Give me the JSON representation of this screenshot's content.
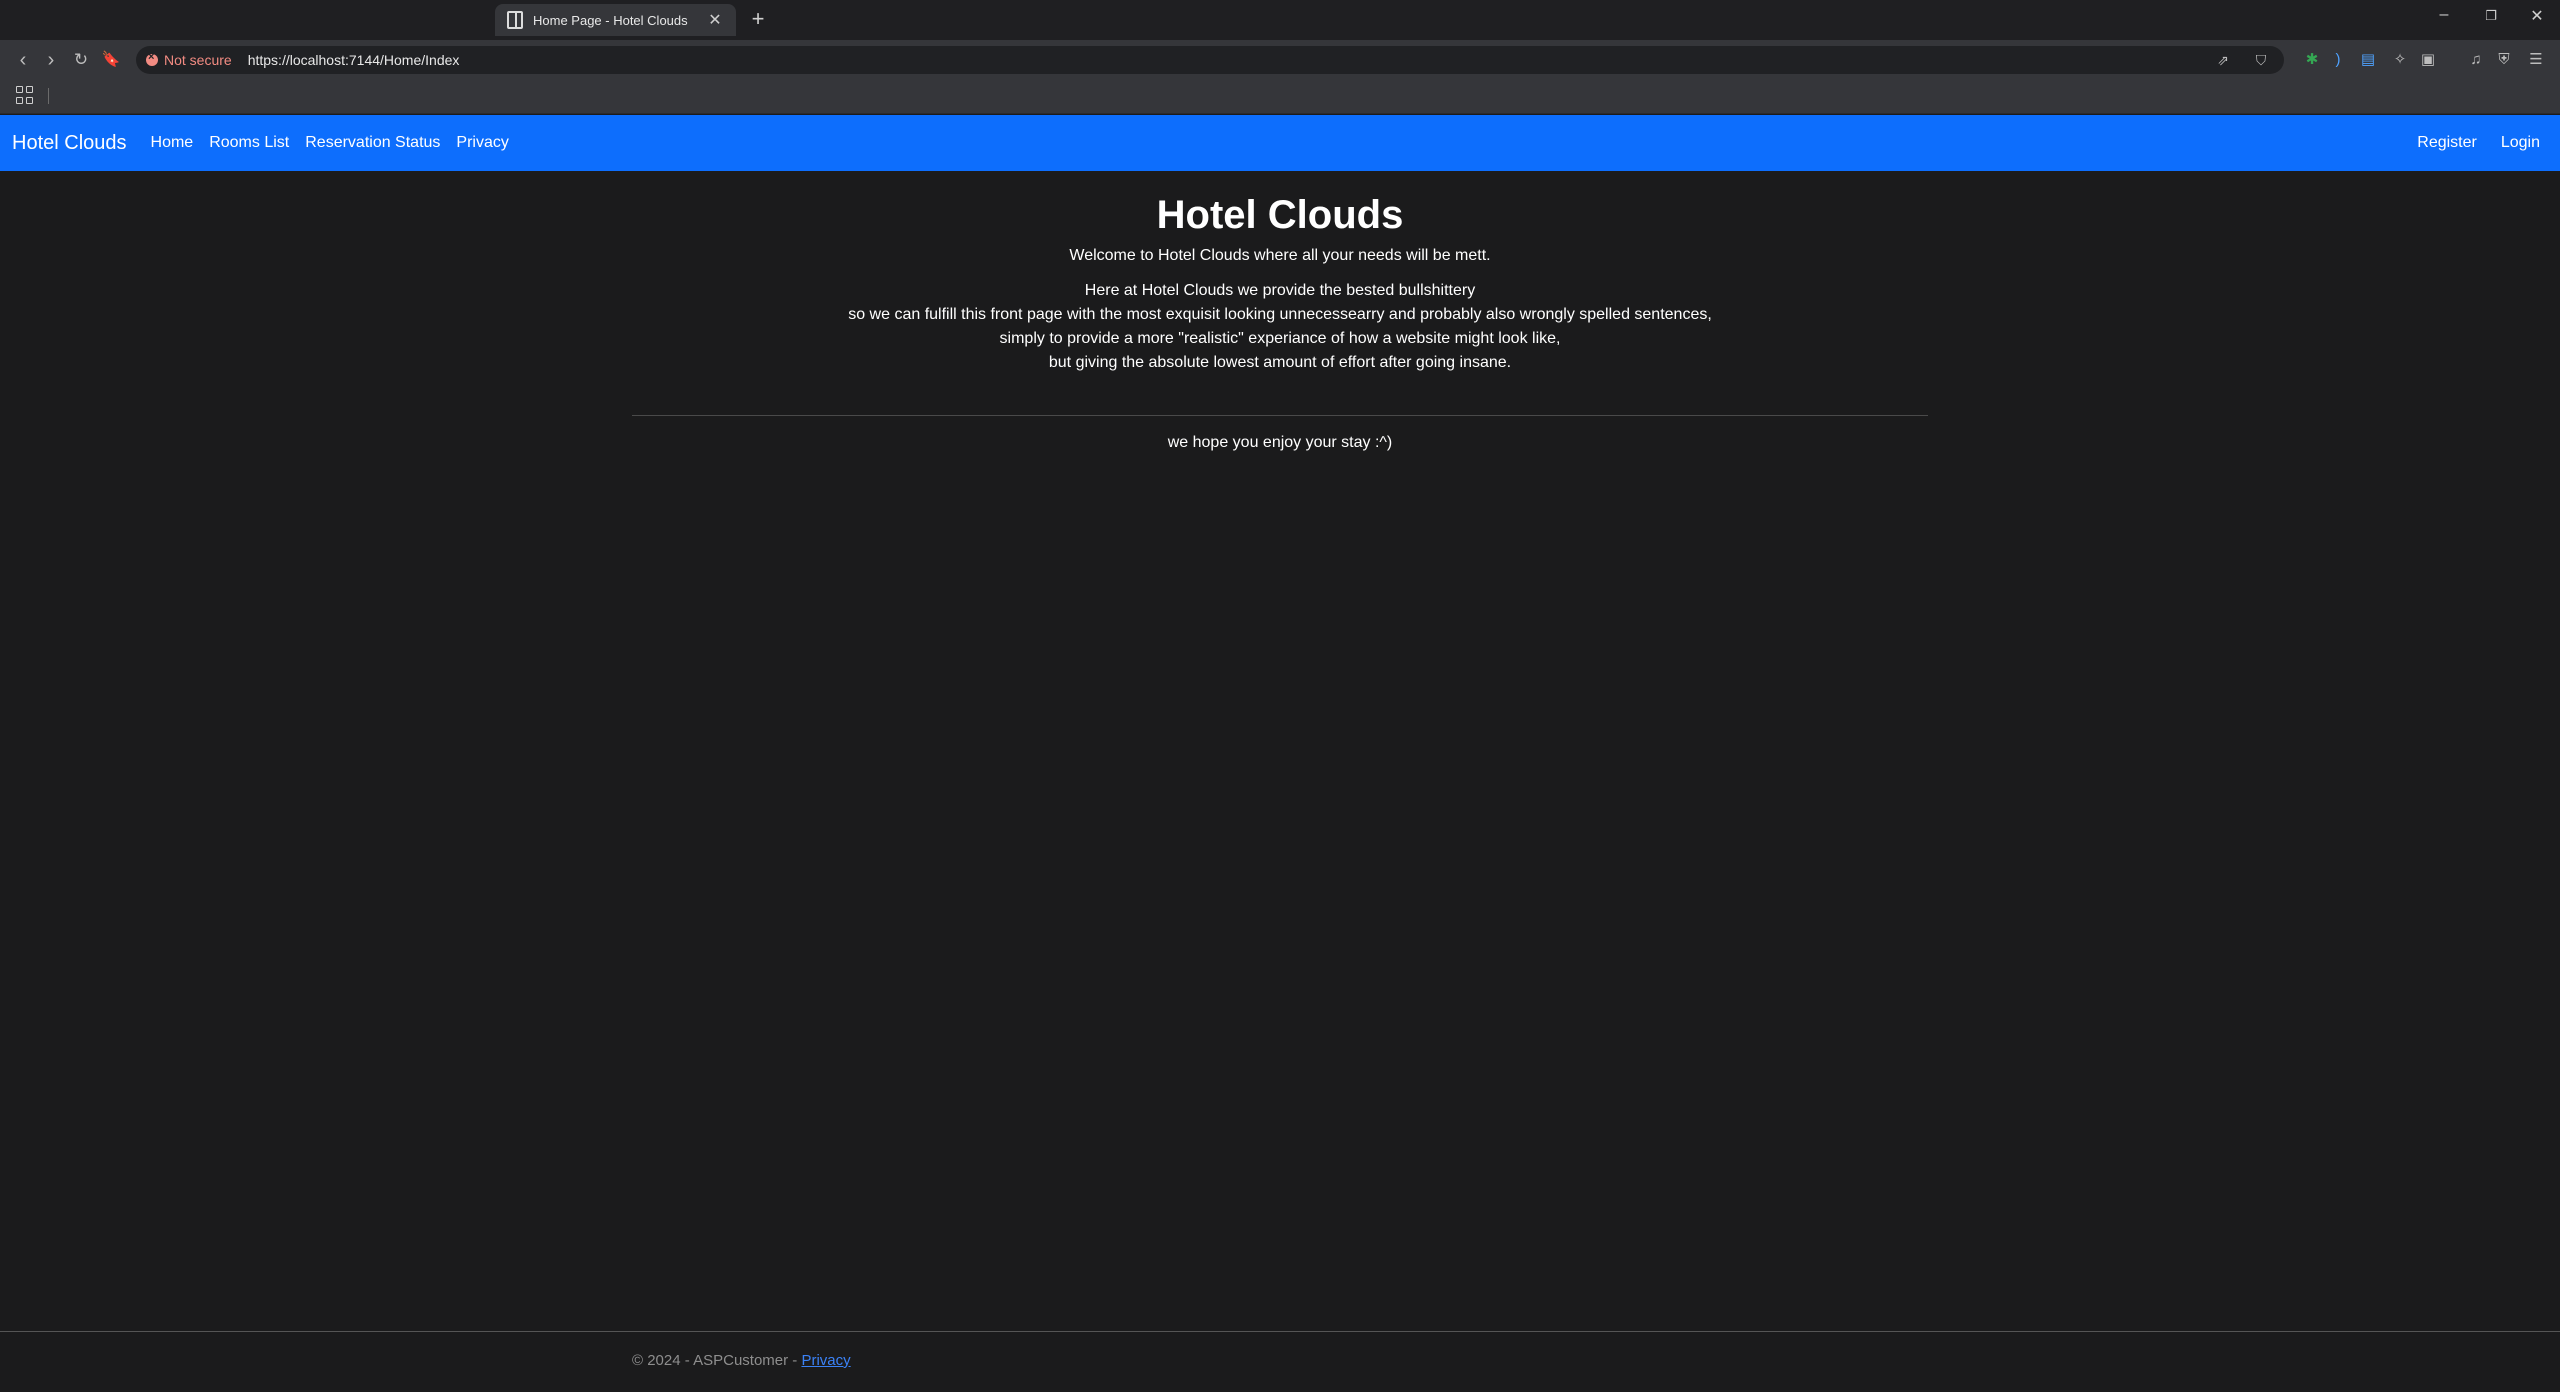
{
  "browser": {
    "tab_title": "Home Page - Hotel Clouds",
    "security_label": "Not secure",
    "url": "https://localhost:7144/Home/Index"
  },
  "navbar": {
    "brand": "Hotel Clouds",
    "links": [
      "Home",
      "Rooms List",
      "Reservation Status",
      "Privacy"
    ],
    "right_links": [
      "Register",
      "Login"
    ],
    "bg_color": "#0d6efd"
  },
  "main": {
    "title": "Hotel Clouds",
    "welcome": "Welcome to Hotel Clouds where all your needs will be mett.",
    "body_lines": [
      "Here at Hotel Clouds we provide the bested bullshittery",
      "so we can fulfill this front page with the most exquisit looking unnecessearry and probably also wrongly spelled sentences,",
      "simply to provide a more \"realistic\" experiance of how a website might look like,",
      "but giving the absolute lowest amount of effort after going insane."
    ],
    "closing": "we hope you enjoy your stay :^)"
  },
  "footer": {
    "copyright": "© 2024 - ASPCustomer - ",
    "privacy_link": "Privacy"
  }
}
